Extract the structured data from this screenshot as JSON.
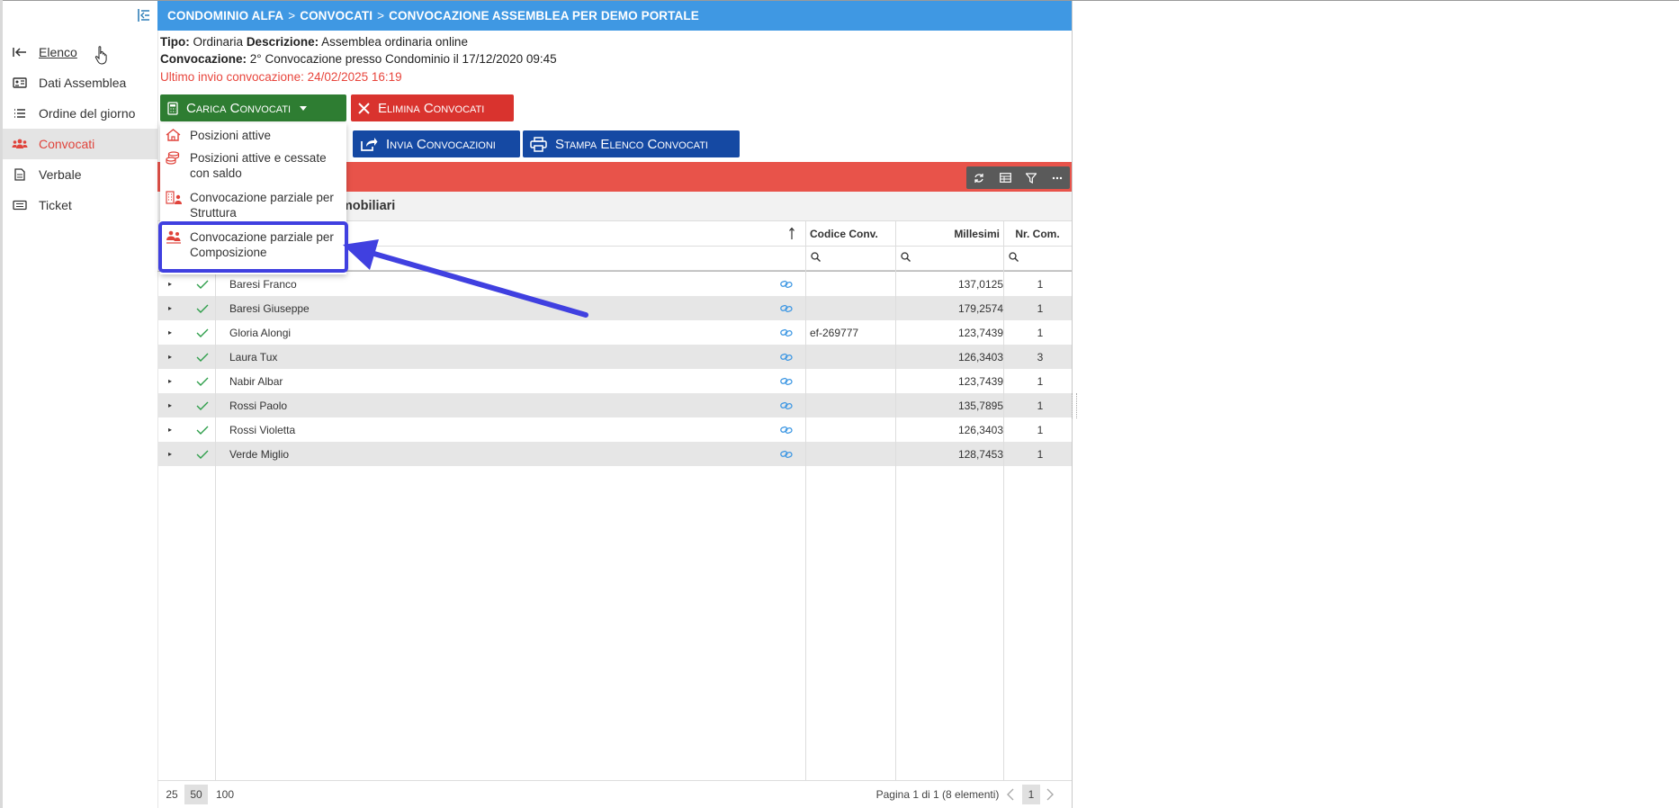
{
  "sidebar": {
    "collapse_icon": "sidebar-collapse-icon",
    "items": [
      {
        "label": "Elenco",
        "icon": "back-arrow-icon"
      },
      {
        "label": "Dati Assemblea",
        "icon": "id-card-icon"
      },
      {
        "label": "Ordine del giorno",
        "icon": "list-icon"
      },
      {
        "label": "Convocati",
        "icon": "users-icon"
      },
      {
        "label": "Verbale",
        "icon": "document-icon"
      },
      {
        "label": "Ticket",
        "icon": "ticket-icon"
      }
    ]
  },
  "breadcrumb": {
    "part1": "CONDOMINIO ALFA",
    "part2": "CONVOCATI",
    "part3": "CONVOCAZIONE ASSEMBLEA PER DEMO PORTALE",
    "separator": ">"
  },
  "info": {
    "tipo_label": "Tipo:",
    "tipo_value": "Ordinaria",
    "descrizione_label": "Descrizione:",
    "descrizione_value": "Assemblea ordinaria online",
    "convocazione_label": "Convocazione:",
    "convocazione_value": "2° Convocazione presso Condominio il 17/12/2020 09:45",
    "ultimo_invio": "Ultimo invio convocazione: 24/02/2025 16:19"
  },
  "toolbar": {
    "carica": "Carica Convocati",
    "elimina": "Elimina Convocati",
    "invia": "Invia Convocazioni",
    "stampa": "Stampa Elenco Convocati"
  },
  "dropdown": {
    "items": [
      {
        "label": "Posizioni attive",
        "icon": "home-icon"
      },
      {
        "label": "Posizioni attive e cessate con saldo",
        "icon": "coins-icon"
      },
      {
        "label": "Convocazione parziale per Struttura",
        "icon": "building-user-icon"
      },
      {
        "label": "Convocazione parziale per Composizione",
        "icon": "users-group-icon"
      }
    ]
  },
  "group": {
    "label": "mmobiliari"
  },
  "grid": {
    "columns": {
      "code": "Codice Conv.",
      "millesimi": "Millesimi",
      "nr": "Nr. Com."
    },
    "rows": [
      {
        "name": "Baresi Franco",
        "code": "",
        "millesimi": "137,0125",
        "nr": "1"
      },
      {
        "name": "Baresi Giuseppe",
        "code": "",
        "millesimi": "179,2574",
        "nr": "1"
      },
      {
        "name": "Gloria Alongi",
        "code": "ef-269777",
        "millesimi": "123,7439",
        "nr": "1"
      },
      {
        "name": "Laura Tux",
        "code": "",
        "millesimi": "126,3403",
        "nr": "3"
      },
      {
        "name": "Nabir Albar",
        "code": "",
        "millesimi": "123,7439",
        "nr": "1"
      },
      {
        "name": "Rossi Paolo",
        "code": "",
        "millesimi": "135,7895",
        "nr": "1"
      },
      {
        "name": "Rossi Violetta",
        "code": "",
        "millesimi": "126,3403",
        "nr": "1"
      },
      {
        "name": "Verde Miglio",
        "code": "",
        "millesimi": "128,7453",
        "nr": "1"
      }
    ]
  },
  "pager": {
    "sizes": [
      "25",
      "50",
      "100"
    ],
    "selected_size": "50",
    "info": "Pagina 1 di 1 (8 elementi)",
    "current_page": "1"
  },
  "colors": {
    "accent_blue": "#3f98e3",
    "active_red": "#e0443c",
    "highlight": "#4040e0"
  }
}
